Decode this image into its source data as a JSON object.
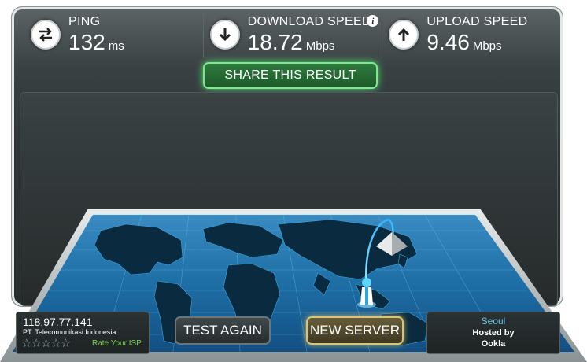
{
  "stats": {
    "ping": {
      "label": "PING",
      "value": "132",
      "unit": "ms",
      "icon": "exchange-arrows-icon"
    },
    "download": {
      "label": "DOWNLOAD SPEED",
      "value": "18.72",
      "unit": "Mbps",
      "icon": "arrow-down-icon",
      "info": "i"
    },
    "upload": {
      "label": "UPLOAD SPEED",
      "value": "9.46",
      "unit": "Mbps",
      "icon": "arrow-up-icon"
    }
  },
  "share_label": "SHARE THIS RESULT",
  "client": {
    "ip": "118.97.77.141",
    "isp": "PT. Telecomunikasi Indonesia",
    "stars": "☆☆☆☆☆",
    "rate_label": "Rate Your ISP"
  },
  "buttons": {
    "test_again": "TEST AGAIN",
    "new_server": "NEW SERVER"
  },
  "server": {
    "city": "Seoul",
    "hosted_by": "Hosted by",
    "host": "Ookla"
  },
  "colors": {
    "accent_green": "#4fe36b",
    "map_blue": "#1f8bd1",
    "new_server_gold": "#d8c57a"
  }
}
